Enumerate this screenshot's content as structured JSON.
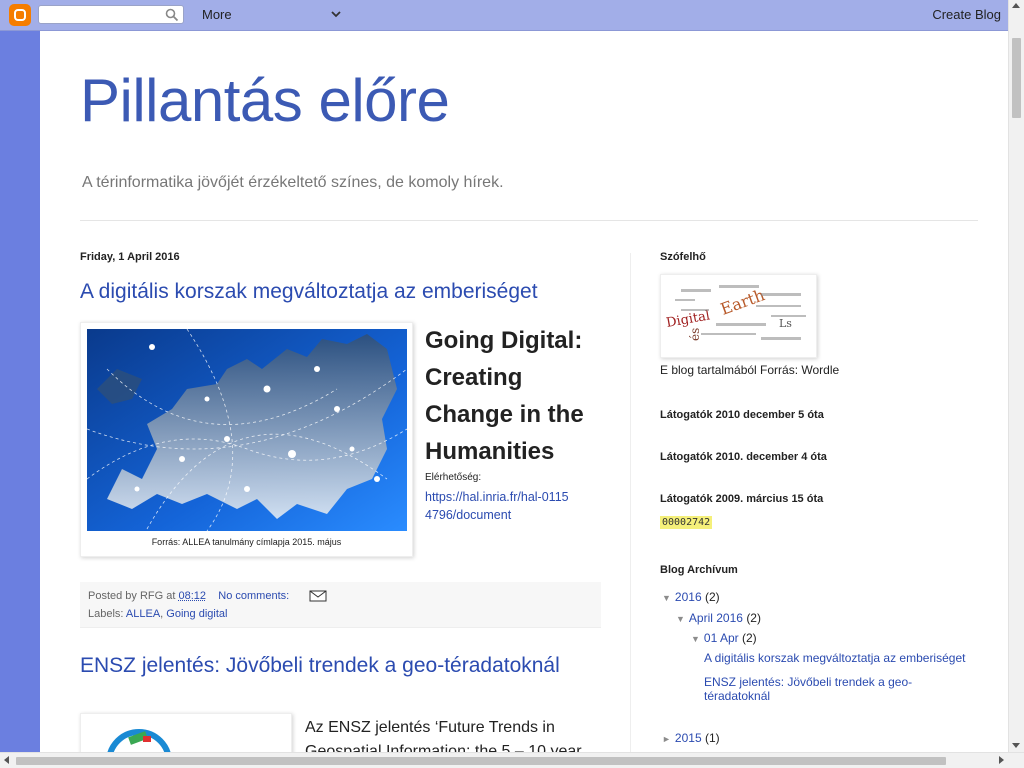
{
  "navbar": {
    "search_placeholder": "",
    "more_label": "More",
    "create_blog_label": "Create Blog"
  },
  "blog": {
    "title": "Pillantás előre",
    "description": "A térinformatika jövőjét érzékeltető színes, de komoly hírek."
  },
  "post1": {
    "date": "Friday, 1 April 2016",
    "title": "A digitális korszak megváltoztatja az emberiséget",
    "image_caption": "Forrás: ALLEA tanulmány címlapja 2015. május",
    "heading": "Going Digital: Creating Change in the Humanities",
    "avail_label": "Elérhetőség:",
    "avail_url": "https://hal.inria.fr/hal-01154796/document",
    "posted_by_prefix": "Posted by ",
    "author": "RFG",
    "at_word": " at ",
    "time": "08:12",
    "comments": "No comments:",
    "labels_prefix": "Labels: ",
    "label1": "ALLEA",
    "label_sep": ", ",
    "label2": "Going digital"
  },
  "post2": {
    "title": "ENSZ jelentés: Jövőbeli trendek a geo-téradatoknál",
    "text": "Az ENSZ jelentés ‘Future Trends in Geospatial Information: the 5 – 10 year"
  },
  "sidebar": {
    "wordcloud_title": "Szófelhő",
    "wordcloud_caption": "E blog tartalmából Forrás: Wordle",
    "visitors1": "Látogatók 2010 december 5 óta",
    "visitors2": "Látogatók 2010. december 4 óta",
    "visitors3": "Látogatók 2009. március 15 óta",
    "counter": "00002742",
    "archive_title": "Blog Archívum",
    "archive": {
      "year_2016": "2016",
      "year_2016_count": "(2)",
      "month_april": "April 2016",
      "month_april_count": "(2)",
      "day_01apr": "01 Apr",
      "day_01apr_count": "(2)",
      "post_a": "A digitális korszak megváltoztatja az emberiséget",
      "post_b": "ENSZ jelentés: Jövőbeli trendek a geo-téradatoknál",
      "year_2015": "2015",
      "year_2015_count": "(1)"
    }
  },
  "colors": {
    "page_bg": "#6b7fe0",
    "link": "#2b4bb0",
    "title": "#3c5ab4",
    "counter_bg": "#f5f07a"
  }
}
